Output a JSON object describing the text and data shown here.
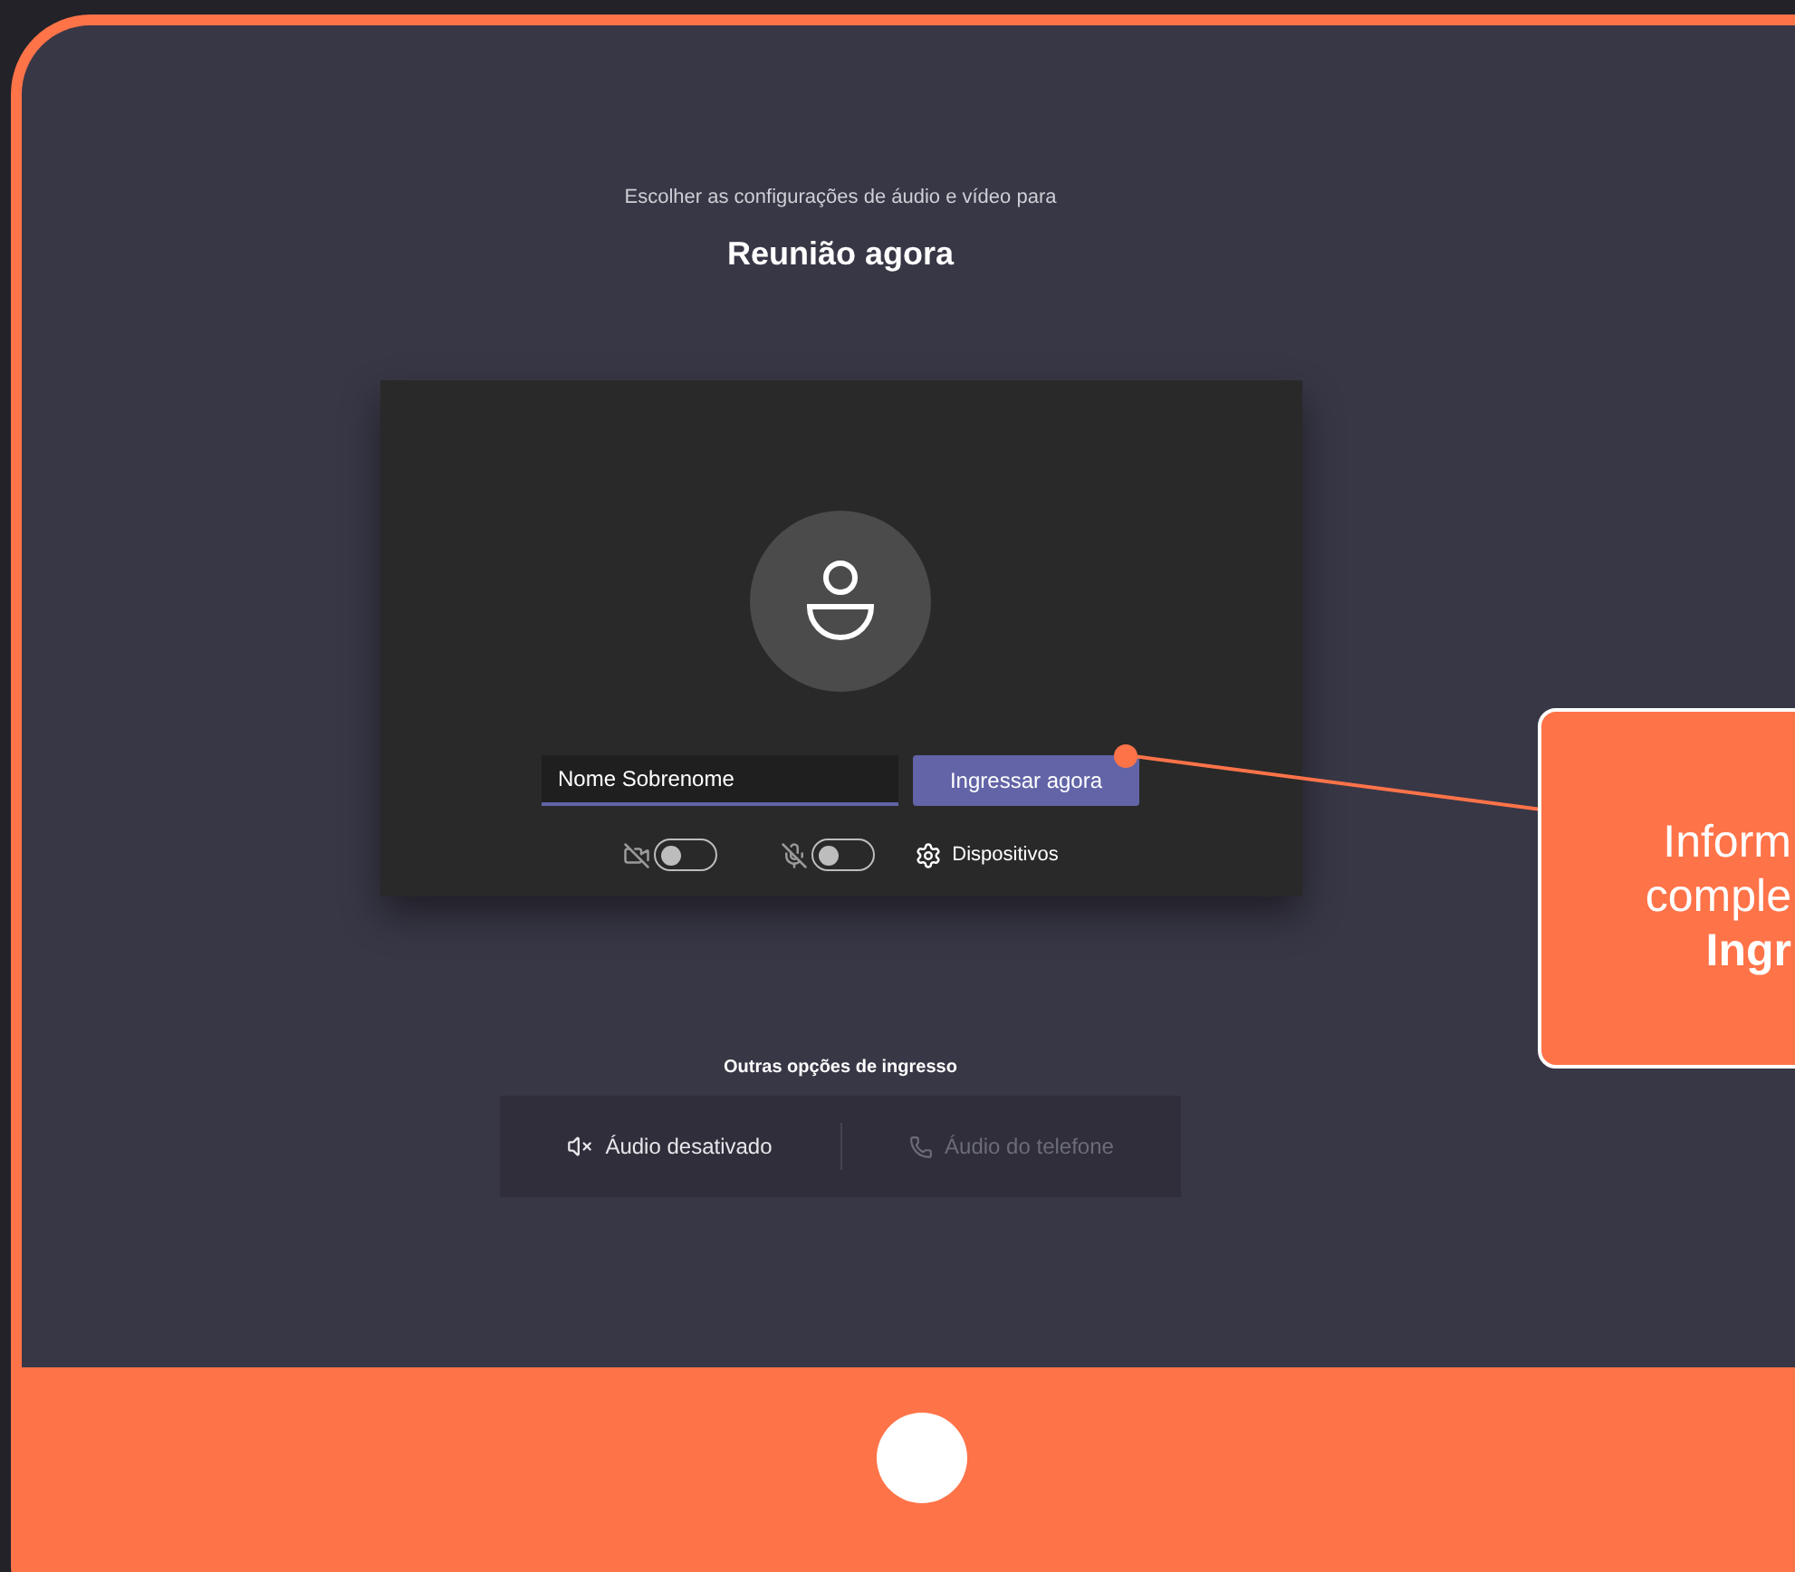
{
  "meeting": {
    "subtitle": "Escolher as configurações de áudio e vídeo para",
    "title": "Reunião agora"
  },
  "preview": {
    "name_field": {
      "value": "Nome Sobrenome"
    },
    "join_button": {
      "label": "Ingressar agora"
    },
    "camera_toggle": {
      "on": false
    },
    "mic_toggle": {
      "on": false
    },
    "devices_button": {
      "label": "Dispositivos"
    }
  },
  "other_options": {
    "heading": "Outras opções de ingresso",
    "items": [
      {
        "label": "Áudio desativado",
        "kind": "audio-off",
        "disabled": false
      },
      {
        "label": "Áudio do telefone",
        "kind": "phone",
        "disabled": true
      }
    ]
  },
  "callout": {
    "lines": [
      {
        "text": "Inform",
        "bold": false
      },
      {
        "text": "comple",
        "bold": false
      },
      {
        "text": "Ingr",
        "bold": true
      }
    ]
  }
}
